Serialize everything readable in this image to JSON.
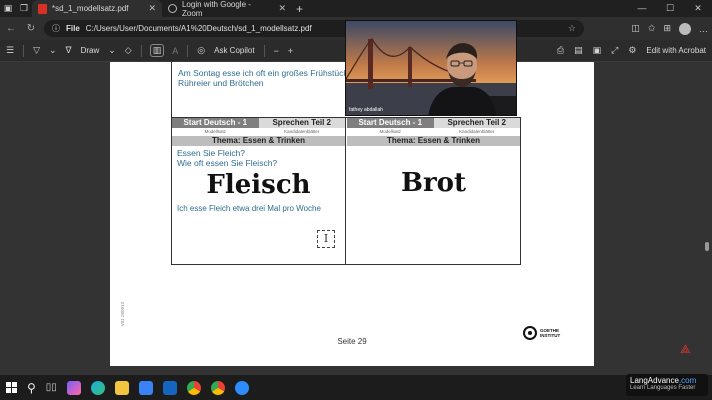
{
  "browser": {
    "tabs": [
      {
        "title": "*sd_1_modellsatz.pdf",
        "active": true
      },
      {
        "title": "Login with Google - Zoom",
        "active": false
      }
    ],
    "address": {
      "badge": "File",
      "url": "C:/Users/User/Documents/A1%20Deutsch/sd_1_modellsatz.pdf"
    }
  },
  "pdf_toolbar": {
    "draw_label": "Draw",
    "ask_copilot_label": "Ask Copilot",
    "edit_acrobat_label": "Edit with Acrobat"
  },
  "page": {
    "top_text_line1": "Am Sontag esse ich oft ein großes Frühstück",
    "top_text_line2": "Rühreier und Brötchen",
    "left_card": {
      "header_a": "Start Deutsch - 1",
      "header_b": "Sprechen Teil 2",
      "sub_a": "Modellsatz",
      "sub_b": "Kandidatenblätter",
      "theme": "Thema: Essen & Trinken",
      "question1": "Essen Sie Fleich?",
      "question2": "Wie oft essen Sie Fleisch?",
      "word": "Fleisch",
      "answer": "Ich esse Fleich etwa drei Mal pro Woche"
    },
    "right_card": {
      "header_a": "Start Deutsch - 1",
      "header_b": "Sprechen Teil 2",
      "sub_a": "Modellsatz",
      "sub_b": "Kandidatenblätter",
      "theme": "Thema: Essen & Trinken",
      "word": "Brot"
    },
    "page_number": "Seite 29",
    "side_code": "V01 280913",
    "goethe_line1": "GOETHE",
    "goethe_line2": "INSTITUT"
  },
  "zoom": {
    "participant": "fathey abdallah"
  },
  "watermark": {
    "brand_a": "LangAdvance",
    "brand_b": ".com",
    "tagline": "Learn Languages Faster"
  },
  "colors": {
    "link_blue": "#2f6d8f",
    "header_gray": "#7f7f7f"
  }
}
